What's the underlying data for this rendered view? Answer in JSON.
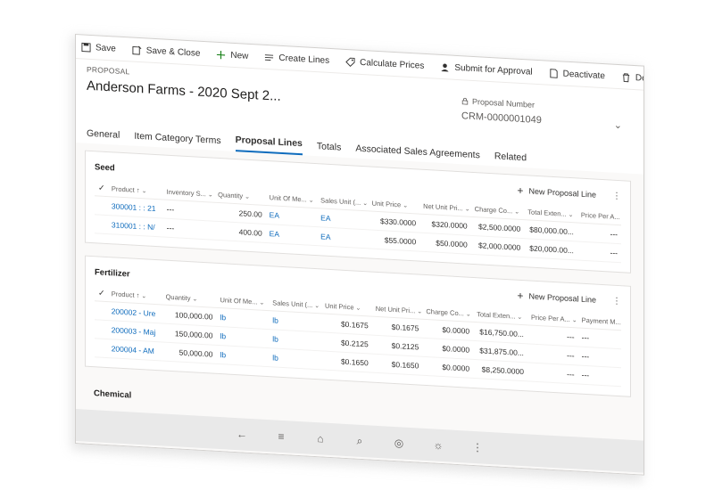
{
  "toolbar": {
    "save": "Save",
    "save_close": "Save & Close",
    "new": "New",
    "create_lines": "Create Lines",
    "calculate_prices": "Calculate Prices",
    "submit_for_approval": "Submit for Approval",
    "deactivate": "Deactivate",
    "delete": "Delete",
    "more": "⋮"
  },
  "header": {
    "entity_type": "PROPOSAL",
    "title": "Anderson Farms - 2020 Sept 2...",
    "proposal_number_label": "Proposal Number",
    "proposal_number_value": "CRM-0000001049"
  },
  "tabs": [
    "General",
    "Item Category Terms",
    "Proposal Lines",
    "Totals",
    "Associated Sales Agreements",
    "Related"
  ],
  "active_tab": "Proposal Lines",
  "seed": {
    "title": "Seed",
    "new_line": "New Proposal Line",
    "columns": [
      "Product ↑",
      "Inventory S...",
      "Quantity",
      "Unit Of Me...",
      "Sales Unit (...",
      "Unit Price",
      "Net Unit Pri...",
      "Charge Co...",
      "Total Exten...",
      "Price Per A..."
    ],
    "rows": [
      {
        "product": "300001 : : 21",
        "inventory": "---",
        "quantity": "250.00",
        "uom": "EA",
        "sales_unit": "EA",
        "unit_price": "$330.0000",
        "net_unit_price": "$320.0000",
        "charge": "$2,500.0000",
        "total": "$80,000.00...",
        "price_per": "---"
      },
      {
        "product": "310001 : : N/",
        "inventory": "---",
        "quantity": "400.00",
        "uom": "EA",
        "sales_unit": "EA",
        "unit_price": "$55.0000",
        "net_unit_price": "$50.0000",
        "charge": "$2,000.0000",
        "total": "$20,000.00...",
        "price_per": "---"
      }
    ]
  },
  "fertilizer": {
    "title": "Fertilizer",
    "new_line": "New Proposal Line",
    "columns": [
      "Product ↑",
      "Quantity",
      "Unit Of Me...",
      "Sales Unit (...",
      "Unit Price",
      "Net Unit Pri...",
      "Charge Co...",
      "Total Exten...",
      "Price Per A...",
      "Payment M..."
    ],
    "rows": [
      {
        "product": "200002 - Ure",
        "quantity": "100,000.00",
        "uom": "lb",
        "sales_unit": "lb",
        "unit_price": "$0.1675",
        "net_unit_price": "$0.1675",
        "charge": "$0.0000",
        "total": "$16,750.00...",
        "price_per": "---",
        "payment": "---"
      },
      {
        "product": "200003 - Maj",
        "quantity": "150,000.00",
        "uom": "lb",
        "sales_unit": "lb",
        "unit_price": "$0.2125",
        "net_unit_price": "$0.2125",
        "charge": "$0.0000",
        "total": "$31,875.00...",
        "price_per": "---",
        "payment": "---"
      },
      {
        "product": "200004 - AM",
        "quantity": "50,000.00",
        "uom": "lb",
        "sales_unit": "lb",
        "unit_price": "$0.1650",
        "net_unit_price": "$0.1650",
        "charge": "$0.0000",
        "total": "$8,250.0000",
        "price_per": "---",
        "payment": "---"
      }
    ]
  },
  "chemical": {
    "title": "Chemical"
  },
  "taskbar": {
    "icons": [
      "back-icon",
      "menu-icon",
      "home-icon",
      "search-icon",
      "compass-icon",
      "lightbulb-icon",
      "more-icon"
    ]
  }
}
